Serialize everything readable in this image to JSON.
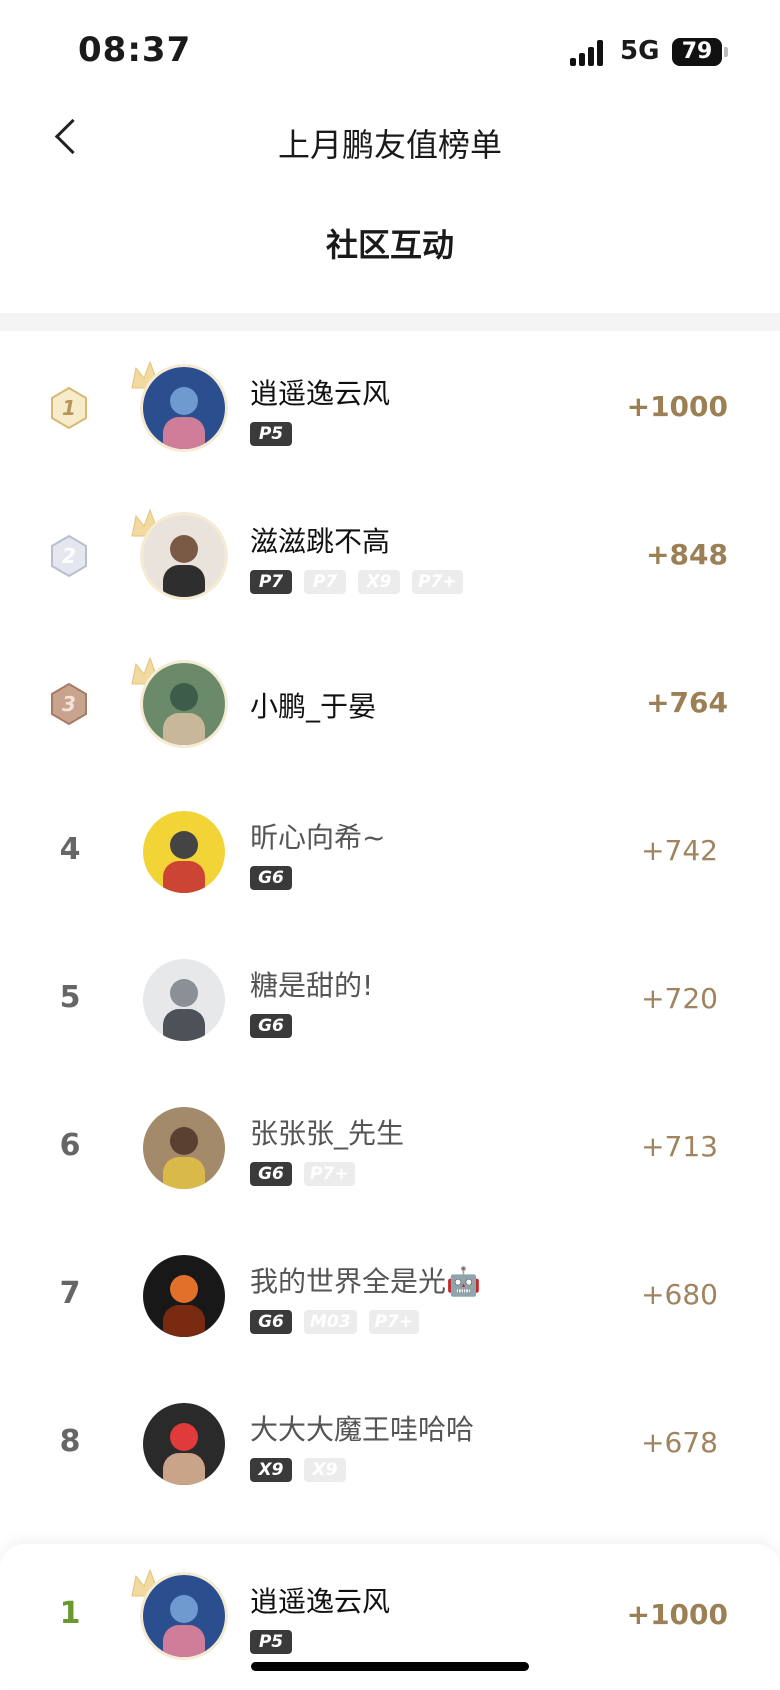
{
  "status_bar": {
    "time": "08:37",
    "network": "5G",
    "battery": "79"
  },
  "nav": {
    "title": "上月鹏友值榜单"
  },
  "subtitle": "社区互动",
  "ranking": [
    {
      "rank": "1",
      "name": "逍遥逸云风",
      "score": "+1000",
      "tags": [
        {
          "label": "P5",
          "active": true
        }
      ]
    },
    {
      "rank": "2",
      "name": "滋滋跳不高",
      "score": "+848",
      "tags": [
        {
          "label": "P7",
          "active": true
        },
        {
          "label": "P7",
          "active": false
        },
        {
          "label": "X9",
          "active": false
        },
        {
          "label": "P7+",
          "active": false
        }
      ]
    },
    {
      "rank": "3",
      "name": "小鹏_于晏",
      "score": "+764",
      "tags": []
    },
    {
      "rank": "4",
      "name": "昕心向希~",
      "score": "+742",
      "tags": [
        {
          "label": "G6",
          "active": true
        }
      ]
    },
    {
      "rank": "5",
      "name": "糖是甜的!",
      "score": "+720",
      "tags": [
        {
          "label": "G6",
          "active": true
        }
      ]
    },
    {
      "rank": "6",
      "name": "张张张_先生",
      "score": "+713",
      "tags": [
        {
          "label": "G6",
          "active": true
        },
        {
          "label": "P7+",
          "active": false
        }
      ]
    },
    {
      "rank": "7",
      "name": "我的世界全是光🤖",
      "score": "+680",
      "tags": [
        {
          "label": "G6",
          "active": true
        },
        {
          "label": "M03",
          "active": false
        },
        {
          "label": "P7+",
          "active": false
        }
      ]
    },
    {
      "rank": "8",
      "name": "大大大魔王哇哈哈",
      "score": "+678",
      "tags": [
        {
          "label": "X9",
          "active": true
        },
        {
          "label": "X9",
          "active": false
        }
      ]
    }
  ],
  "my_rank": {
    "rank": "1",
    "name": "逍遥逸云风",
    "score": "+1000",
    "tags": [
      {
        "label": "P5",
        "active": true
      }
    ]
  },
  "colors": {
    "score": "#a08460",
    "my_rank": "#6a9a2e",
    "tag_active": "#3a3a3a",
    "tag_inactive": "#ececec"
  }
}
